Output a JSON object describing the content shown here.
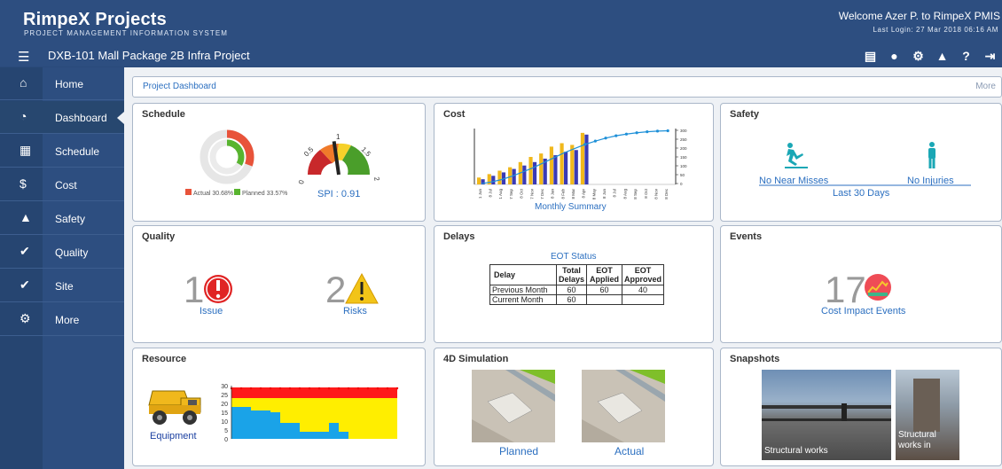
{
  "header": {
    "brand": "RimpeX  Projects",
    "brand_sub": "PROJECT MANAGEMENT INFORMATION SYSTEM",
    "welcome": "Welcome Azer P. to RimpeX PMIS",
    "last_login": "Last Login: 27 Mar 2018 06:16 AM",
    "project_title": "DXB-101 Mall Package 2B Infra Project"
  },
  "sidebar": {
    "items": [
      {
        "label": "Home",
        "icon": "home-icon"
      },
      {
        "label": "Dashboard",
        "icon": "dashboard-icon"
      },
      {
        "label": "Schedule",
        "icon": "calendar-icon"
      },
      {
        "label": "Cost",
        "icon": "dollar-icon"
      },
      {
        "label": "Safety",
        "icon": "cone-icon"
      },
      {
        "label": "Quality",
        "icon": "check-icon"
      },
      {
        "label": "Site",
        "icon": "check-icon"
      },
      {
        "label": "More",
        "icon": "cog-icon"
      }
    ]
  },
  "breadcrumb": {
    "label": "Project Dashboard",
    "more": "More"
  },
  "schedule": {
    "title": "Schedule",
    "actual_pct": 30.68,
    "planned_pct": 33.57,
    "legend_actual": "Actual 30.68%",
    "legend_planned": "Planned 33.57%",
    "spi_label": "SPI : 0.91",
    "gauge_ticks": [
      "0",
      "0.5",
      "1",
      "1.5",
      "2"
    ],
    "spi_value": 0.91,
    "colors": {
      "actual": "#e8533a",
      "planned": "#58b42f"
    }
  },
  "cost": {
    "title": "Cost",
    "subtitle": "Monthly Summary",
    "chart_data": {
      "type": "bar",
      "categories": [
        "1 Jun",
        "8 Jul",
        "1 Aug",
        "7 Sep",
        "8 Oct",
        "7 Nov",
        "7 Dec",
        "8 Jan",
        "8 Feb",
        "8 Mar",
        "8 Apr",
        "8 May",
        "8 Jun",
        "8 Jul",
        "8 Aug",
        "8 Sep",
        "8 Oct",
        "8 Nov",
        "8 Dec"
      ],
      "series": [
        {
          "values": [
            4,
            6,
            8,
            10,
            13,
            16,
            18,
            22,
            24,
            23,
            30,
            0,
            0,
            0,
            0,
            0,
            0,
            0,
            0
          ]
        },
        {
          "values": [
            3,
            5,
            7,
            9,
            11,
            13,
            15,
            17,
            19,
            20,
            29,
            0,
            0,
            0,
            0,
            0,
            0,
            0,
            0
          ]
        }
      ],
      "cumulative": [
        5,
        15,
        30,
        50,
        75,
        100,
        130,
        160,
        190,
        215,
        240,
        260,
        278,
        292,
        302,
        310,
        316,
        320,
        322
      ],
      "right_ticks": [
        "300",
        "250",
        "200",
        "150",
        "100",
        "50",
        "0"
      ]
    }
  },
  "safety": {
    "title": "Safety",
    "near_misses": "No Near Misses",
    "injuries": "No Injuries",
    "period": "Last 30 Days"
  },
  "quality": {
    "title": "Quality",
    "issues_count": "1",
    "issues_label": "Issue",
    "risks_count": "2",
    "risks_label": "Risks"
  },
  "delays": {
    "title": "Delays",
    "subtitle": "EOT Status",
    "headers": [
      "Delay",
      "Total Delays",
      "EOT Applied",
      "EOT Approved"
    ],
    "rows": [
      [
        "Previous Month",
        "60",
        "60",
        "40"
      ],
      [
        "Current Month",
        "60",
        "",
        ""
      ]
    ]
  },
  "events": {
    "title": "Events",
    "count": "17",
    "label": "Cost Impact Events"
  },
  "resource": {
    "title": "Resource",
    "label": "Equipment",
    "chart_data": {
      "type": "area",
      "y_ticks": [
        "30",
        "25",
        "20",
        "15",
        "10",
        "5",
        "0"
      ],
      "ylim": [
        0,
        30
      ],
      "x": [
        0,
        1,
        2,
        3,
        4,
        5,
        6,
        7,
        8,
        9,
        10,
        11,
        12,
        13,
        14,
        15,
        16,
        17
      ],
      "layers": [
        {
          "color": "#1aa3e8",
          "values": [
            18,
            18,
            16,
            16,
            15,
            9,
            9,
            4,
            4,
            4,
            9,
            4,
            0,
            0,
            0,
            0,
            0,
            0
          ]
        },
        {
          "color": "#ffee00",
          "values": [
            23,
            23,
            23,
            23,
            23,
            23,
            23,
            23,
            23,
            23,
            23,
            23,
            23,
            23,
            23,
            23,
            23,
            23
          ]
        },
        {
          "color": "#ff1a1a",
          "values": [
            29,
            29,
            29,
            29,
            29,
            29,
            29,
            29,
            29,
            29,
            29,
            29,
            29,
            29,
            29,
            29,
            29,
            29
          ]
        }
      ]
    }
  },
  "simulation": {
    "title": "4D Simulation",
    "planned": "Planned",
    "actual": "Actual"
  },
  "snapshots": {
    "title": "Snapshots",
    "caption1": "Structural works",
    "caption2": "Structural works in"
  }
}
